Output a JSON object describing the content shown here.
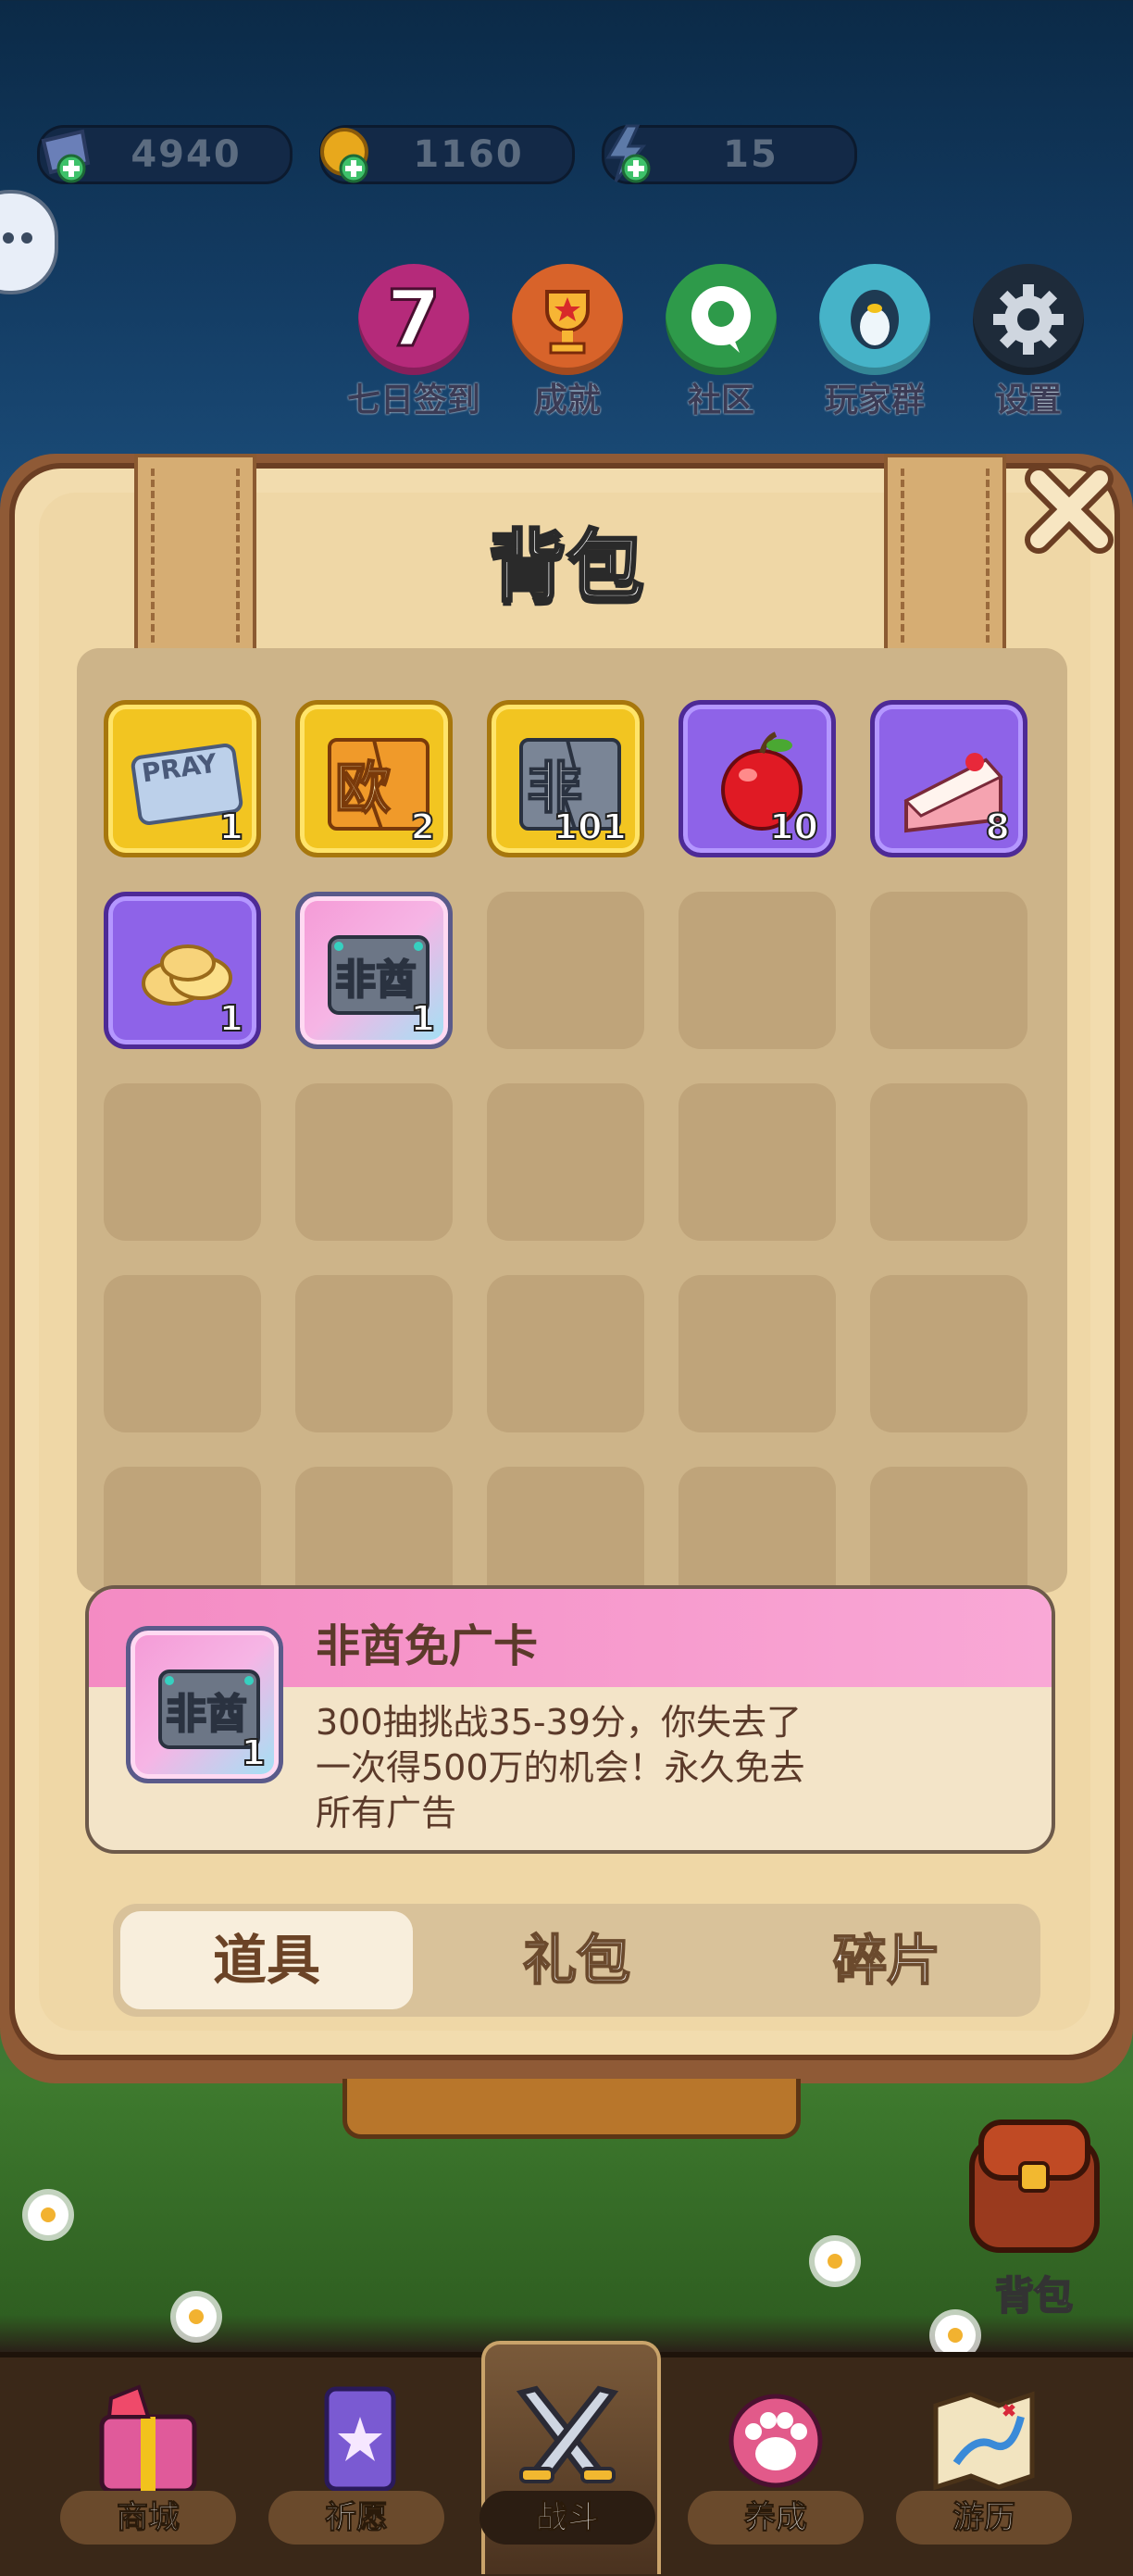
{
  "resources": [
    {
      "name": "diamond",
      "value": "4940"
    },
    {
      "name": "coin",
      "value": "1160"
    },
    {
      "name": "energy",
      "value": "15"
    }
  ],
  "top_menu": [
    {
      "id": "sign-in",
      "label": "七日签到",
      "badge": "7",
      "color": "#b52a7a"
    },
    {
      "id": "achievement",
      "label": "成就",
      "color": "#d8632a"
    },
    {
      "id": "community",
      "label": "社区",
      "color": "#2e9a4a"
    },
    {
      "id": "player-group",
      "label": "玩家群",
      "color": "#46b3c8"
    },
    {
      "id": "settings",
      "label": "设置",
      "color": "#1e2b3a"
    }
  ],
  "panel": {
    "title": "背包"
  },
  "items": [
    {
      "name": "pray-ticket",
      "qty": "1",
      "rarity": "gold",
      "art_text": "PRAY"
    },
    {
      "name": "ou-card-shard",
      "qty": "2",
      "rarity": "gold",
      "art_text": "欧"
    },
    {
      "name": "fei-card-shard",
      "qty": "101",
      "rarity": "gold",
      "art_text": "非"
    },
    {
      "name": "apple",
      "qty": "10",
      "rarity": "purple"
    },
    {
      "name": "cake",
      "qty": "8",
      "rarity": "purple"
    },
    {
      "name": "chips",
      "qty": "1",
      "rarity": "purple"
    },
    {
      "name": "feiyou-ad-card",
      "qty": "1",
      "rarity": "pink",
      "art_text": "非酋"
    }
  ],
  "detail": {
    "name": "非酋免广卡",
    "description": "300抽挑战35-39分，你失去了一次得500万的机会！永久免去所有广告",
    "qty": "1",
    "art_text": "非酋"
  },
  "tabs": [
    {
      "label": "道具",
      "active": true
    },
    {
      "label": "礼包",
      "active": false
    },
    {
      "label": "碎片",
      "active": false
    }
  ],
  "side_button": {
    "label": "背包"
  },
  "nav": [
    {
      "id": "shop",
      "label": "商城"
    },
    {
      "id": "pray",
      "label": "祈愿"
    },
    {
      "id": "battle",
      "label": "战斗",
      "active": true
    },
    {
      "id": "cultivate",
      "label": "养成"
    },
    {
      "id": "travel",
      "label": "游历"
    }
  ]
}
